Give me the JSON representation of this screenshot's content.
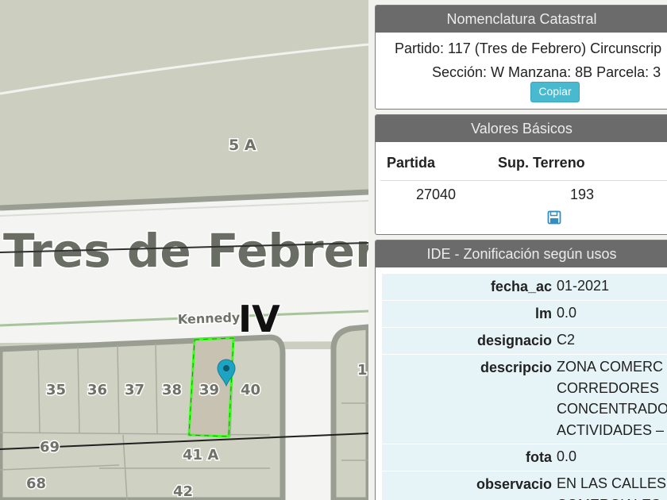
{
  "map": {
    "labels": {
      "lot_5a": "5 A",
      "partido_name": "Tres de Febrer",
      "street": "Kennedy",
      "circunscripcion": "IV",
      "p35": "35",
      "p36": "36",
      "p37": "37",
      "p38": "38",
      "p39": "39",
      "p40": "40",
      "p1": "1",
      "p69": "69",
      "p41a": "41 A",
      "p68": "68",
      "p42": "42"
    },
    "colors": {
      "land": "#cccfbf",
      "road": "#f4f4f2",
      "parcel_border": "#9a9e92",
      "selection": "#39ff1a",
      "marker": "#1ea3c2"
    }
  },
  "nomenclatura": {
    "title": "Nomenclatura Catastral",
    "line1": "Partido: 117 (Tres de Febrero) Circunscrip",
    "line2": "Sección: W Manzana: 8B Parcela: 3",
    "copy_label": "Copiar"
  },
  "valores": {
    "title": "Valores Básicos",
    "col_partida": "Partida",
    "col_sup": "Sup. Terreno",
    "partida": "27040",
    "sup": "193",
    "save_icon": "floppy-disk-icon"
  },
  "ide": {
    "title": "IDE - Zonificación según usos",
    "rows": [
      {
        "key": "fecha_ac",
        "lines": [
          "01-2021"
        ]
      },
      {
        "key": "lm",
        "lines": [
          "0.0"
        ]
      },
      {
        "key": "designacio",
        "lines": [
          "C2"
        ]
      },
      {
        "key": "descripcio",
        "lines": [
          "ZONA COMERC",
          "CORREDORES",
          "CONCENTRADO",
          "ACTIVIDADES – C"
        ]
      },
      {
        "key": "fota",
        "lines": [
          "0.0"
        ]
      },
      {
        "key": "observacio",
        "lines": [
          "EN LAS CALLES",
          "COMERCIALES"
        ]
      }
    ]
  }
}
